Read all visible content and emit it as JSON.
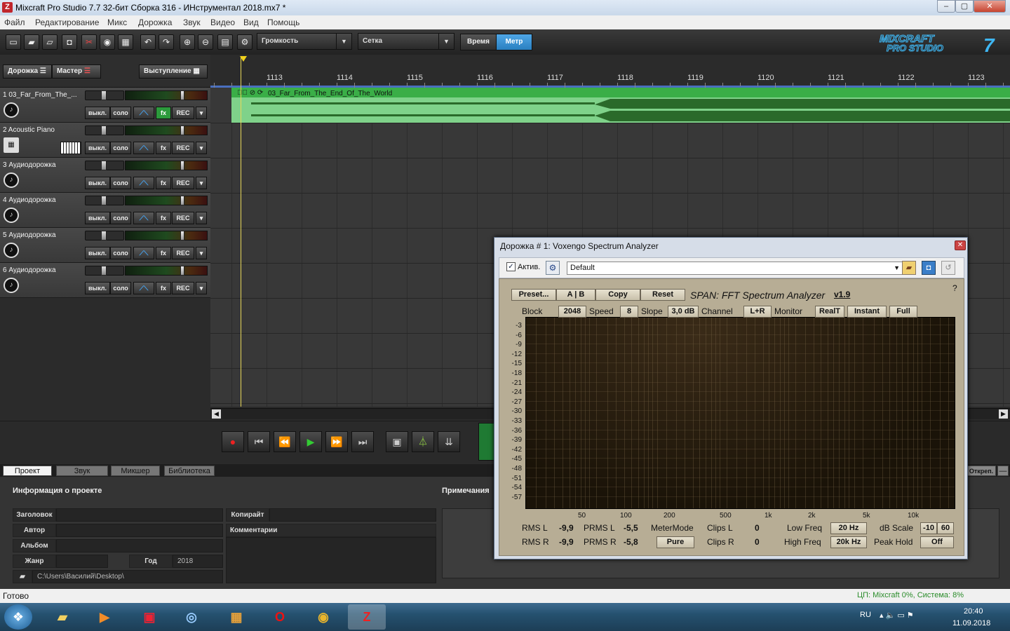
{
  "window": {
    "title": "Mixcraft Pro Studio 7.7 32-бит Сборка 316 - ИНструментал 2018.mx7 *",
    "app_icon": "Z"
  },
  "menu": [
    "Файл",
    "Редактирование",
    "Микс",
    "Дорожка",
    "Звук",
    "Видео",
    "Вид",
    "Помощь"
  ],
  "toolbar": {
    "volume_dropdown": "Громкость",
    "grid_dropdown": "Сетка",
    "time_button": "Время",
    "meter_button": "Метр",
    "logo_top": "MIXCRAFT",
    "logo_bottom": "PRO STUDIO",
    "logo_num": "7"
  },
  "track_header": {
    "tracks_button": "Дорожка",
    "master_button": "Мастер",
    "performance_button": "Выступление"
  },
  "tracks": [
    {
      "name": "1 03_Far_From_The_...",
      "mute": "выкл.",
      "solo": "соло",
      "fx": "fx",
      "rec": "REC",
      "fx_active": true
    },
    {
      "name": "2 Acoustic Piano",
      "mute": "выкл.",
      "solo": "соло",
      "fx": "fx",
      "rec": "REC",
      "fx_active": false
    },
    {
      "name": "3 Аудиодорожка",
      "mute": "выкл.",
      "solo": "соло",
      "fx": "fx",
      "rec": "REC",
      "fx_active": false
    },
    {
      "name": "4 Аудиодорожка",
      "mute": "выкл.",
      "solo": "соло",
      "fx": "fx",
      "rec": "REC",
      "fx_active": false
    },
    {
      "name": "5 Аудиодорожка",
      "mute": "выкл.",
      "solo": "соло",
      "fx": "fx",
      "rec": "REC",
      "fx_active": false
    },
    {
      "name": "6 Аудиодорожка",
      "mute": "выкл.",
      "solo": "соло",
      "fx": "fx",
      "rec": "REC",
      "fx_active": false
    }
  ],
  "ruler": [
    "1113",
    "1114",
    "1115",
    "1116",
    "1117",
    "1118",
    "1119",
    "1120",
    "1121",
    "1122",
    "1123"
  ],
  "clip": {
    "label": "03_Far_From_The_End_Of_The_World"
  },
  "bottom_tabs": [
    "Проект",
    "Звук",
    "Микшер",
    "Библиотека"
  ],
  "project": {
    "info_header": "Информация о проекте",
    "notes_header": "Примечания",
    "title_label": "Заголовок",
    "author_label": "Автор",
    "album_label": "Альбом",
    "genre_label": "Жанр",
    "year_label": "Год",
    "year_value": "2018",
    "copyright_label": "Копирайт",
    "comments_label": "Комментарии",
    "path": "C:\\Users\\Василий\\Desktop\\",
    "detach": "Откреп."
  },
  "status": {
    "left": "Готово",
    "right": "ЦП: Mixcraft 0%, Система: 8%"
  },
  "plugin": {
    "title": "Дорожка # 1: Voxengo Spectrum Analyzer",
    "active_label": "Актив.",
    "preset_value": "Default",
    "buttons": [
      "Preset...",
      "A | B",
      "Copy",
      "Reset"
    ],
    "span_title": "SPAN: FFT Spectrum Analyzer",
    "version": "v1.9",
    "help": "?",
    "row2": [
      {
        "l": "Block",
        "v": "2048"
      },
      {
        "l": "Speed",
        "v": "8"
      },
      {
        "l": "Slope",
        "v": "3,0 dB"
      },
      {
        "l": "Channel",
        "v": "L+R"
      },
      {
        "l": "Monitor",
        "v": "RealT"
      },
      {
        "l": "",
        "v": "Instant"
      },
      {
        "l": "",
        "v": "Full"
      }
    ],
    "db_labels": [
      "-3",
      "-6",
      "-9",
      "-12",
      "-15",
      "-18",
      "-21",
      "-24",
      "-27",
      "-30",
      "-33",
      "-36",
      "-39",
      "-42",
      "-45",
      "-48",
      "-51",
      "-54",
      "-57"
    ],
    "freq_labels": [
      "50",
      "100",
      "200",
      "500",
      "1k",
      "2k",
      "5k",
      "10k"
    ],
    "rms_l": "RMS L",
    "rms_l_v": "-9,9",
    "rms_r": "RMS R",
    "rms_r_v": "-9,9",
    "prms_l": "PRMS L",
    "prms_l_v": "-5,5",
    "prms_r": "PRMS R",
    "prms_r_v": "-5,8",
    "metermode": "MeterMode",
    "metermode_v": "Pure",
    "clips_l": "Clips L",
    "clips_l_v": "0",
    "clips_r": "Clips R",
    "clips_r_v": "0",
    "low_freq": "Low Freq",
    "low_freq_v": "20 Hz",
    "high_freq": "High Freq",
    "high_freq_v": "20k Hz",
    "db_scale": "dB Scale",
    "db_scale_a": "-10",
    "db_scale_b": "60",
    "peak_hold": "Peak Hold",
    "peak_hold_v": "Off"
  },
  "taskbar": {
    "lang": "RU",
    "time": "20:40",
    "date": "11.09.2018"
  }
}
